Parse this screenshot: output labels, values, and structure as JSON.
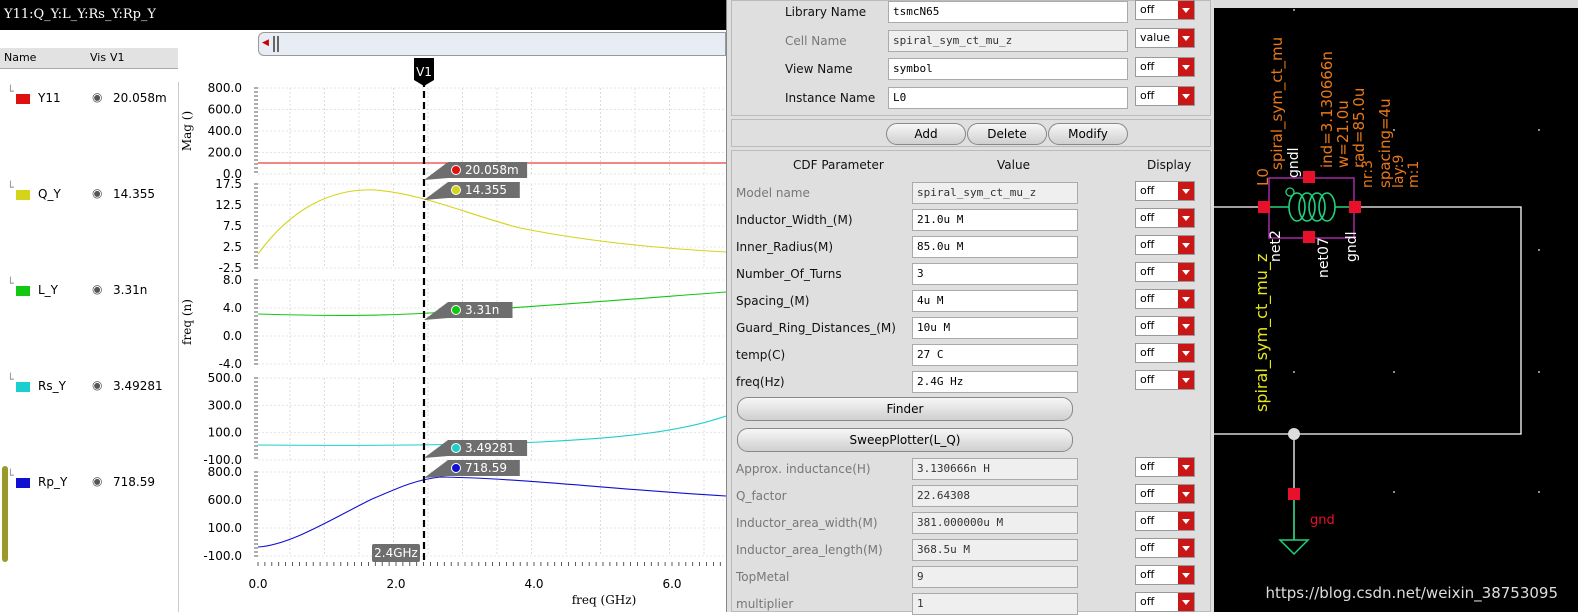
{
  "viewer": {
    "title": "Y11:Q_Y:L_Y:Rs_Y:Rp_Y",
    "legend_headers": {
      "name": "Name",
      "vis": "Vis",
      "v1": "V1"
    },
    "legend": [
      {
        "name": "Y11",
        "value": "20.058m",
        "color": "#e01010"
      },
      {
        "name": "Q_Y",
        "value": "14.355",
        "color": "#d4d41a"
      },
      {
        "name": "L_Y",
        "value": "3.31n",
        "color": "#12c812"
      },
      {
        "name": "Rs_Y",
        "value": "3.49281",
        "color": "#1ccfcf"
      },
      {
        "name": "Rp_Y",
        "value": "718.59",
        "color": "#1010d0"
      }
    ],
    "marker_name": "V1",
    "marker_freq_label": "2.4GHz",
    "xaxis_label": "freq (GHz)",
    "xticks": [
      "0.0",
      "2.0",
      "4.0",
      "6.0"
    ],
    "strips": [
      {
        "ylabel": "Mag ()",
        "yticks": [
          "800.0",
          "600.0",
          "400.0",
          "200.0",
          "0.0"
        ],
        "marker_value": "20.058m",
        "color": "#e01010"
      },
      {
        "ylabel": "",
        "yticks": [
          "17.5",
          "12.5",
          "7.5",
          "2.5",
          "-2.5"
        ],
        "marker_value": "14.355",
        "color": "#d4d41a"
      },
      {
        "ylabel": "freq (n)",
        "yticks": [
          "8.0",
          "4.0",
          "0.0",
          "-4.0"
        ],
        "marker_value": "3.31n",
        "color": "#12c812"
      },
      {
        "ylabel": "",
        "yticks": [
          "500.0",
          "300.0",
          "100.0",
          "-100.0"
        ],
        "marker_value": "3.49281",
        "color": "#1ccfcf"
      },
      {
        "ylabel": "",
        "yticks": [
          "800.0",
          "600.0",
          "100.0",
          "-100.0"
        ],
        "marker_value": "718.59",
        "color": "#1010d0"
      }
    ]
  },
  "form": {
    "top_fields": [
      {
        "label": "Library Name",
        "value": "tsmcN65",
        "display": "off",
        "readonly": false
      },
      {
        "label": "Cell Name",
        "value": "spiral_sym_ct_mu_z",
        "display": "value",
        "readonly": true
      },
      {
        "label": "View Name",
        "value": "symbol",
        "display": "off",
        "readonly": false
      },
      {
        "label": "Instance Name",
        "value": "L0",
        "display": "off",
        "readonly": false
      }
    ],
    "buttons": {
      "add": "Add",
      "delete": "Delete",
      "modify": "Modify"
    },
    "headers": {
      "param": "CDF Parameter",
      "value": "Value",
      "display": "Display"
    },
    "params": [
      {
        "label": "Model name",
        "value": "spiral_sym_ct_mu_z",
        "display": "off",
        "readonly": true
      },
      {
        "label": "Inductor_Width_(M)",
        "value": "21.0u M",
        "display": "off",
        "readonly": false
      },
      {
        "label": "Inner_Radius(M)",
        "value": "85.0u M",
        "display": "off",
        "readonly": false
      },
      {
        "label": "Number_Of_Turns",
        "value": "3",
        "display": "off",
        "readonly": false
      },
      {
        "label": "Spacing_(M)",
        "value": "4u M",
        "display": "off",
        "readonly": false
      },
      {
        "label": "Guard_Ring_Distances_(M)",
        "value": "10u M",
        "display": "off",
        "readonly": false
      },
      {
        "label": "temp(C)",
        "value": "27 C",
        "display": "off",
        "readonly": false
      },
      {
        "label": "freq(Hz)",
        "value": "2.4G Hz",
        "display": "off",
        "readonly": false
      }
    ],
    "finder_label": "Finder",
    "sweep_label": "SweepPlotter(L_Q)",
    "results": [
      {
        "label": "Approx. inductance(H)",
        "value": "3.130666n H",
        "display": "off"
      },
      {
        "label": "Q_factor",
        "value": "22.64308",
        "display": "off"
      },
      {
        "label": "Inductor_area_width(M)",
        "value": "381.000000u M",
        "display": "off"
      },
      {
        "label": "Inductor_area_length(M)",
        "value": "368.5u M",
        "display": "off"
      },
      {
        "label": "TopMetal",
        "value": "9",
        "display": "off"
      },
      {
        "label": "multiplier",
        "value": "1",
        "display": "off"
      }
    ]
  },
  "schematic": {
    "instance_label": "L0",
    "cell_label": "spiral_sym_ct_mu_z",
    "cell_label_top": "spiral_sym_ct_mu",
    "params": [
      "ind=3.130666n",
      "w=21.0u",
      "rad=85.0u",
      "nr:3",
      "spacing=4u",
      "lay:9",
      "m:1"
    ],
    "pins": {
      "gndl_top": "gndl",
      "net2": "net2",
      "net07": "net07",
      "gndl": "gndl"
    },
    "gnd_label": "gnd",
    "watermark": "https://blog.csdn.net/weixin_38753095"
  }
}
